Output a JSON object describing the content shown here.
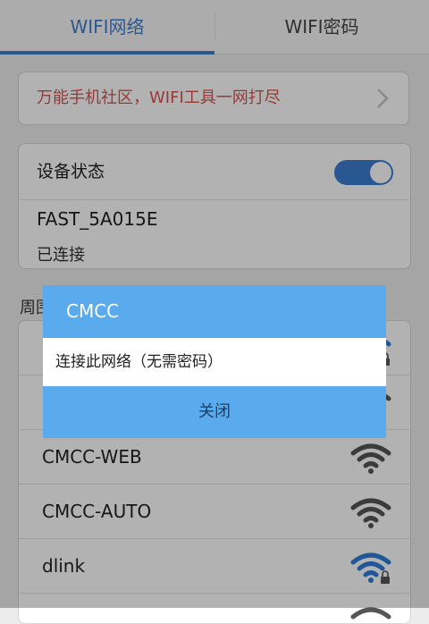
{
  "tabs": [
    {
      "label": "WIFI网络",
      "active": true
    },
    {
      "label": "WIFI密码",
      "active": false
    }
  ],
  "promo": {
    "text": "万能手机社区，WIFI工具一网打尽",
    "icon": "chevron-right-icon"
  },
  "device_status": {
    "label": "设备状态",
    "toggle_on": true,
    "connected_ssid": "FAST_5A015E",
    "connection_state": "已连接"
  },
  "nearby_label": "周围",
  "networks": [
    {
      "name": "",
      "locked": true
    },
    {
      "name": "",
      "locked": true
    },
    {
      "name": "CMCC-WEB",
      "locked": false
    },
    {
      "name": "CMCC-AUTO",
      "locked": false
    },
    {
      "name": "dlink",
      "locked": true
    },
    {
      "name": "",
      "locked": false
    }
  ],
  "dialog": {
    "title": "CMCC",
    "message": "连接此网络（无需密码）",
    "close_button": "关闭"
  },
  "colors": {
    "accent": "#3f7fd0",
    "dialog_blue": "#5aabed",
    "promo_red": "#d9534f",
    "wifi_active": "#2f7ed8",
    "wifi_inactive": "#555555"
  }
}
